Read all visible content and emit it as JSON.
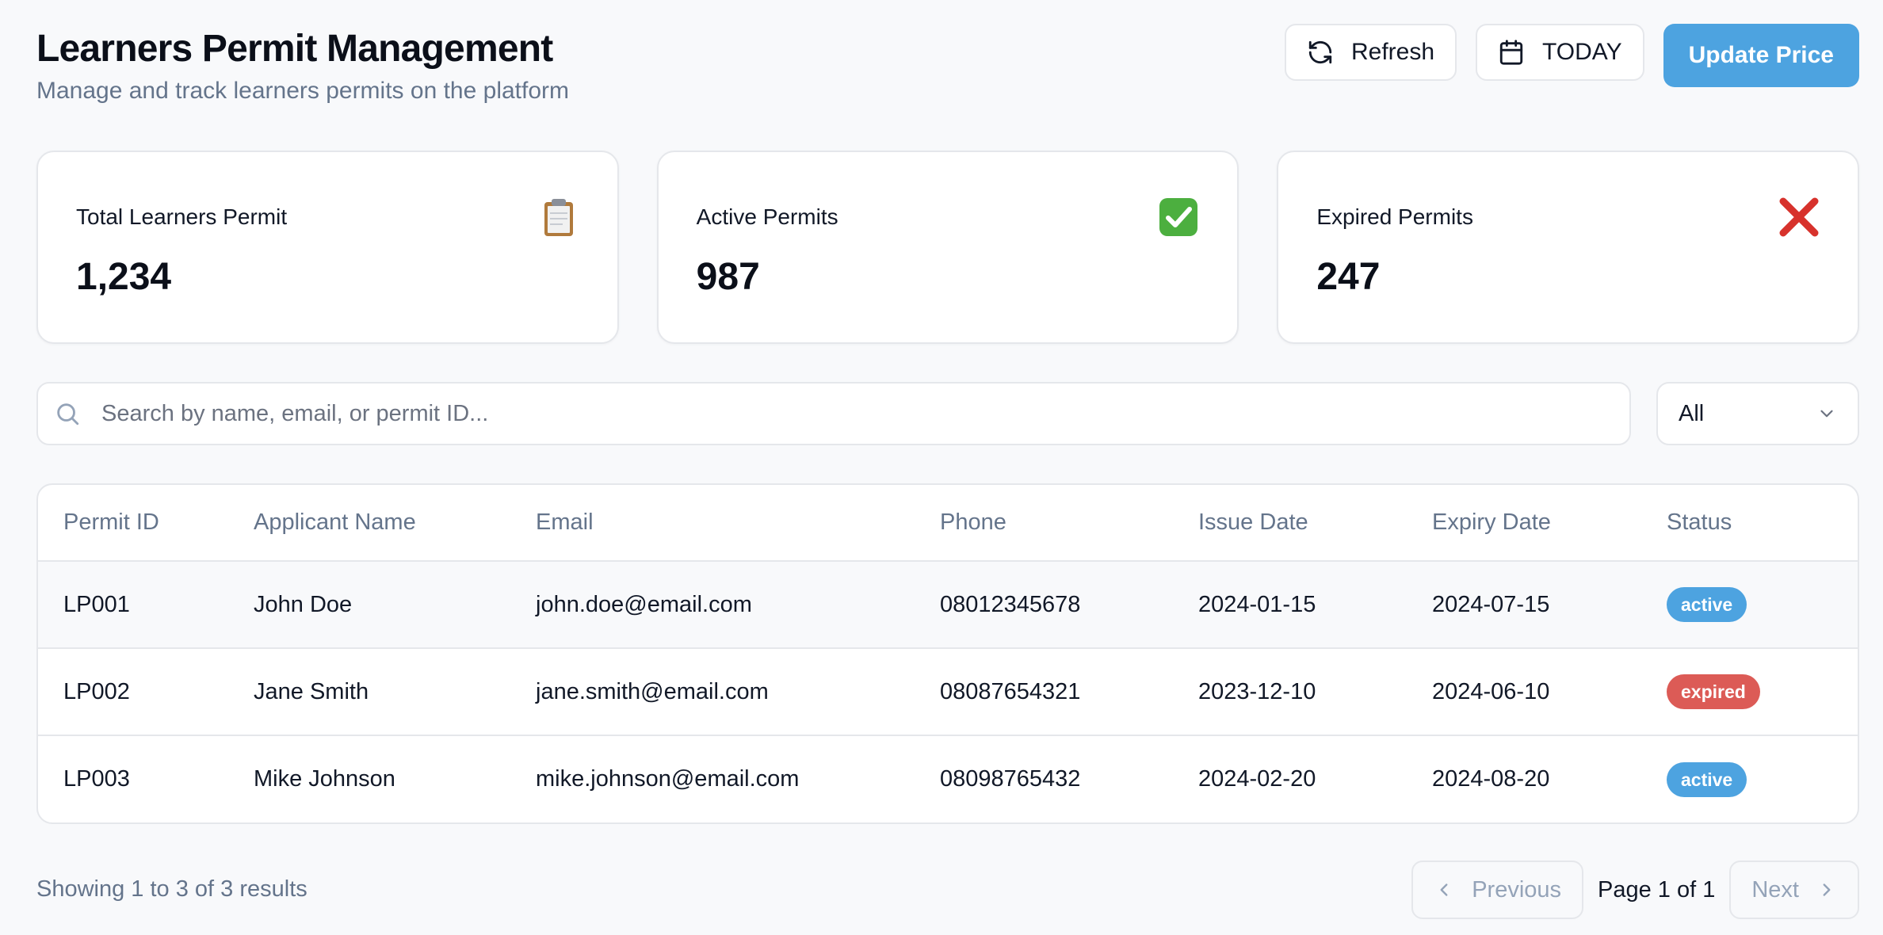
{
  "header": {
    "title": "Learners Permit Management",
    "subtitle": "Manage and track learners permits on the platform",
    "refresh_label": "Refresh",
    "date_label": "TODAY",
    "update_label": "Update Price"
  },
  "stats": [
    {
      "label": "Total Learners Permit",
      "value": "1,234",
      "icon": "clipboard-icon"
    },
    {
      "label": "Active Permits",
      "value": "987",
      "icon": "check-mark-icon"
    },
    {
      "label": "Expired Permits",
      "value": "247",
      "icon": "cross-mark-icon"
    }
  ],
  "search": {
    "placeholder": "Search by name, email, or permit ID...",
    "value": ""
  },
  "filter": {
    "selected": "All"
  },
  "table": {
    "columns": [
      "Permit ID",
      "Applicant Name",
      "Email",
      "Phone",
      "Issue Date",
      "Expiry Date",
      "Status"
    ],
    "rows": [
      {
        "id": "LP001",
        "name": "John Doe",
        "email": "john.doe@email.com",
        "phone": "08012345678",
        "issue": "2024-01-15",
        "expiry": "2024-07-15",
        "status": "active"
      },
      {
        "id": "LP002",
        "name": "Jane Smith",
        "email": "jane.smith@email.com",
        "phone": "08087654321",
        "issue": "2023-12-10",
        "expiry": "2024-06-10",
        "status": "expired"
      },
      {
        "id": "LP003",
        "name": "Mike Johnson",
        "email": "mike.johnson@email.com",
        "phone": "08098765432",
        "issue": "2024-02-20",
        "expiry": "2024-08-20",
        "status": "active"
      }
    ]
  },
  "status_colors": {
    "active": "#4da3e0",
    "expired": "#dc5b56"
  },
  "colors": {
    "primary": "#4da3e0",
    "page_bg": "#f8f9fb",
    "border": "#e5e7eb",
    "muted_text": "#64748b"
  },
  "footer": {
    "results_text": "Showing 1 to 3 of 3 results",
    "previous_label": "Previous",
    "page_info": "Page 1 of 1",
    "next_label": "Next"
  }
}
